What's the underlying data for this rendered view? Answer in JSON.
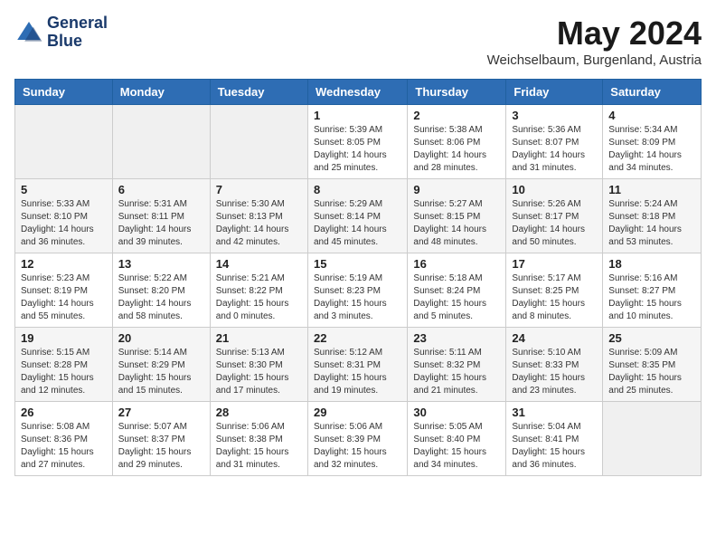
{
  "logo": {
    "line1": "General",
    "line2": "Blue"
  },
  "title": "May 2024",
  "subtitle": "Weichselbaum, Burgenland, Austria",
  "weekdays": [
    "Sunday",
    "Monday",
    "Tuesday",
    "Wednesday",
    "Thursday",
    "Friday",
    "Saturday"
  ],
  "weeks": [
    [
      {
        "day": "",
        "sunrise": "",
        "sunset": "",
        "daylight": ""
      },
      {
        "day": "",
        "sunrise": "",
        "sunset": "",
        "daylight": ""
      },
      {
        "day": "",
        "sunrise": "",
        "sunset": "",
        "daylight": ""
      },
      {
        "day": "1",
        "sunrise": "Sunrise: 5:39 AM",
        "sunset": "Sunset: 8:05 PM",
        "daylight": "Daylight: 14 hours and 25 minutes."
      },
      {
        "day": "2",
        "sunrise": "Sunrise: 5:38 AM",
        "sunset": "Sunset: 8:06 PM",
        "daylight": "Daylight: 14 hours and 28 minutes."
      },
      {
        "day": "3",
        "sunrise": "Sunrise: 5:36 AM",
        "sunset": "Sunset: 8:07 PM",
        "daylight": "Daylight: 14 hours and 31 minutes."
      },
      {
        "day": "4",
        "sunrise": "Sunrise: 5:34 AM",
        "sunset": "Sunset: 8:09 PM",
        "daylight": "Daylight: 14 hours and 34 minutes."
      }
    ],
    [
      {
        "day": "5",
        "sunrise": "Sunrise: 5:33 AM",
        "sunset": "Sunset: 8:10 PM",
        "daylight": "Daylight: 14 hours and 36 minutes."
      },
      {
        "day": "6",
        "sunrise": "Sunrise: 5:31 AM",
        "sunset": "Sunset: 8:11 PM",
        "daylight": "Daylight: 14 hours and 39 minutes."
      },
      {
        "day": "7",
        "sunrise": "Sunrise: 5:30 AM",
        "sunset": "Sunset: 8:13 PM",
        "daylight": "Daylight: 14 hours and 42 minutes."
      },
      {
        "day": "8",
        "sunrise": "Sunrise: 5:29 AM",
        "sunset": "Sunset: 8:14 PM",
        "daylight": "Daylight: 14 hours and 45 minutes."
      },
      {
        "day": "9",
        "sunrise": "Sunrise: 5:27 AM",
        "sunset": "Sunset: 8:15 PM",
        "daylight": "Daylight: 14 hours and 48 minutes."
      },
      {
        "day": "10",
        "sunrise": "Sunrise: 5:26 AM",
        "sunset": "Sunset: 8:17 PM",
        "daylight": "Daylight: 14 hours and 50 minutes."
      },
      {
        "day": "11",
        "sunrise": "Sunrise: 5:24 AM",
        "sunset": "Sunset: 8:18 PM",
        "daylight": "Daylight: 14 hours and 53 minutes."
      }
    ],
    [
      {
        "day": "12",
        "sunrise": "Sunrise: 5:23 AM",
        "sunset": "Sunset: 8:19 PM",
        "daylight": "Daylight: 14 hours and 55 minutes."
      },
      {
        "day": "13",
        "sunrise": "Sunrise: 5:22 AM",
        "sunset": "Sunset: 8:20 PM",
        "daylight": "Daylight: 14 hours and 58 minutes."
      },
      {
        "day": "14",
        "sunrise": "Sunrise: 5:21 AM",
        "sunset": "Sunset: 8:22 PM",
        "daylight": "Daylight: 15 hours and 0 minutes."
      },
      {
        "day": "15",
        "sunrise": "Sunrise: 5:19 AM",
        "sunset": "Sunset: 8:23 PM",
        "daylight": "Daylight: 15 hours and 3 minutes."
      },
      {
        "day": "16",
        "sunrise": "Sunrise: 5:18 AM",
        "sunset": "Sunset: 8:24 PM",
        "daylight": "Daylight: 15 hours and 5 minutes."
      },
      {
        "day": "17",
        "sunrise": "Sunrise: 5:17 AM",
        "sunset": "Sunset: 8:25 PM",
        "daylight": "Daylight: 15 hours and 8 minutes."
      },
      {
        "day": "18",
        "sunrise": "Sunrise: 5:16 AM",
        "sunset": "Sunset: 8:27 PM",
        "daylight": "Daylight: 15 hours and 10 minutes."
      }
    ],
    [
      {
        "day": "19",
        "sunrise": "Sunrise: 5:15 AM",
        "sunset": "Sunset: 8:28 PM",
        "daylight": "Daylight: 15 hours and 12 minutes."
      },
      {
        "day": "20",
        "sunrise": "Sunrise: 5:14 AM",
        "sunset": "Sunset: 8:29 PM",
        "daylight": "Daylight: 15 hours and 15 minutes."
      },
      {
        "day": "21",
        "sunrise": "Sunrise: 5:13 AM",
        "sunset": "Sunset: 8:30 PM",
        "daylight": "Daylight: 15 hours and 17 minutes."
      },
      {
        "day": "22",
        "sunrise": "Sunrise: 5:12 AM",
        "sunset": "Sunset: 8:31 PM",
        "daylight": "Daylight: 15 hours and 19 minutes."
      },
      {
        "day": "23",
        "sunrise": "Sunrise: 5:11 AM",
        "sunset": "Sunset: 8:32 PM",
        "daylight": "Daylight: 15 hours and 21 minutes."
      },
      {
        "day": "24",
        "sunrise": "Sunrise: 5:10 AM",
        "sunset": "Sunset: 8:33 PM",
        "daylight": "Daylight: 15 hours and 23 minutes."
      },
      {
        "day": "25",
        "sunrise": "Sunrise: 5:09 AM",
        "sunset": "Sunset: 8:35 PM",
        "daylight": "Daylight: 15 hours and 25 minutes."
      }
    ],
    [
      {
        "day": "26",
        "sunrise": "Sunrise: 5:08 AM",
        "sunset": "Sunset: 8:36 PM",
        "daylight": "Daylight: 15 hours and 27 minutes."
      },
      {
        "day": "27",
        "sunrise": "Sunrise: 5:07 AM",
        "sunset": "Sunset: 8:37 PM",
        "daylight": "Daylight: 15 hours and 29 minutes."
      },
      {
        "day": "28",
        "sunrise": "Sunrise: 5:06 AM",
        "sunset": "Sunset: 8:38 PM",
        "daylight": "Daylight: 15 hours and 31 minutes."
      },
      {
        "day": "29",
        "sunrise": "Sunrise: 5:06 AM",
        "sunset": "Sunset: 8:39 PM",
        "daylight": "Daylight: 15 hours and 32 minutes."
      },
      {
        "day": "30",
        "sunrise": "Sunrise: 5:05 AM",
        "sunset": "Sunset: 8:40 PM",
        "daylight": "Daylight: 15 hours and 34 minutes."
      },
      {
        "day": "31",
        "sunrise": "Sunrise: 5:04 AM",
        "sunset": "Sunset: 8:41 PM",
        "daylight": "Daylight: 15 hours and 36 minutes."
      },
      {
        "day": "",
        "sunrise": "",
        "sunset": "",
        "daylight": ""
      }
    ]
  ]
}
